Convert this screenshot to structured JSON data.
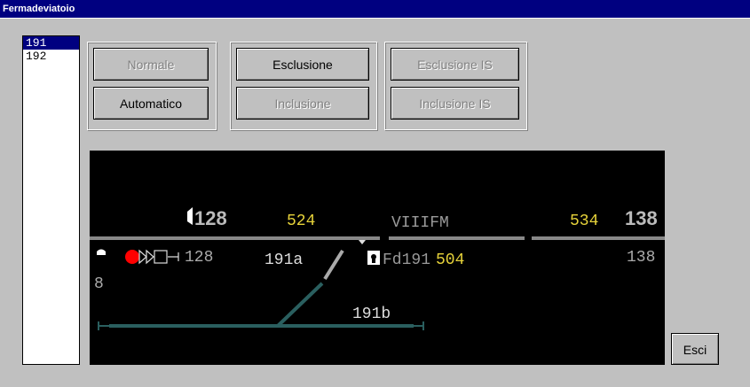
{
  "window": {
    "title": "Fermadeviatoio"
  },
  "list": {
    "items": [
      "191",
      "192"
    ],
    "selected": "191"
  },
  "buttons": {
    "normale": "Normale",
    "automatico": "Automatico",
    "esclusione": "Esclusione",
    "inclusione": "Inclusione",
    "esclusione_is": "Esclusione IS",
    "inclusione_is": "Inclusione IS",
    "esci": "Esci"
  },
  "diagram": {
    "signal_left": "128",
    "num_524": "524",
    "label_viiifm": "VIIIFM",
    "num_534": "534",
    "signal_right": "138",
    "signal_row_128": "128",
    "label_191a": "191a",
    "label_fd191": "Fd191",
    "num_504": "504",
    "signal_row_138": "138",
    "num_8": "8",
    "label_191b": "191b"
  }
}
